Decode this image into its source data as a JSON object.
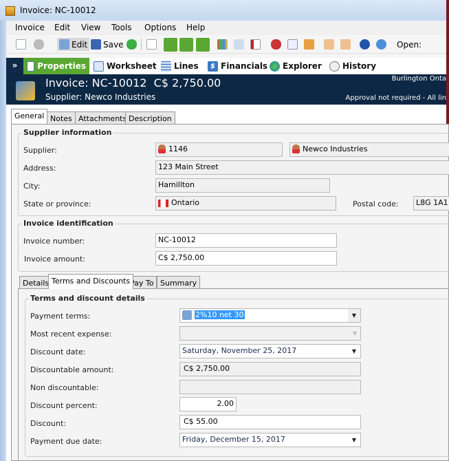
{
  "window": {
    "title": "Invoice: NC-10012"
  },
  "menu": [
    "Invoice",
    "Edit",
    "View",
    "Tools",
    "Options",
    "Help"
  ],
  "toolbar": {
    "edit_label": "Edit",
    "save_label": "Save",
    "open_label": "Open:"
  },
  "nav": {
    "tabs": [
      {
        "label": "Properties",
        "icon": "properties-icon",
        "active": true
      },
      {
        "label": "Worksheet",
        "icon": "worksheet-icon"
      },
      {
        "label": "Lines",
        "icon": "grid-icon"
      },
      {
        "label": "Financials",
        "icon": "dollar-icon"
      },
      {
        "label": "Explorer",
        "icon": "globe-icon"
      },
      {
        "label": "History",
        "icon": "clock-icon"
      }
    ]
  },
  "header": {
    "title": "Invoice: NC-10012  C$ 2,750.00",
    "subtitle": "Supplier: Newco Industries",
    "location": "Burlington Onta",
    "status": "Approval not required - All lin"
  },
  "tabs": [
    "General",
    "Notes",
    "Attachments",
    "Description"
  ],
  "supplier_info": {
    "title": "Supplier information",
    "supplier_label": "Supplier:",
    "supplier_id": "1146",
    "supplier_name": "Newco Industries",
    "address_label": "Address:",
    "address": "123 Main Street",
    "city_label": "City:",
    "city": "Hamillton",
    "province_label": "State or province:",
    "province": "Ontario",
    "postal_label": "Postal code:",
    "postal": "L8G 1A1"
  },
  "invoice_id": {
    "title": "Invoice identification",
    "number_label": "Invoice number:",
    "number": "NC-10012",
    "amount_label": "Invoice amount:",
    "amount": "C$ 2,750.00"
  },
  "subtabs": [
    "Details",
    "Terms and Discounts",
    "Pay To",
    "Summary"
  ],
  "terms": {
    "title": "Terms and discount details",
    "payment_terms_label": "Payment terms:",
    "payment_terms": "2%10 net 30",
    "recent_expense_label": "Most recent expense:",
    "recent_expense": "",
    "discount_date_label": "Discount date:",
    "discount_date": "Saturday, November 25, 2017",
    "discountable_label": "Discountable amount:",
    "discountable": "C$ 2,750.00",
    "non_discountable_label": "Non discountable:",
    "non_discountable": "",
    "percent_label": "Discount percent:",
    "percent": "2.00",
    "discount_label": "Discount:",
    "discount": "C$ 55.00",
    "due_date_label": "Payment due date:",
    "due_date": "Friday, December 15, 2017"
  }
}
